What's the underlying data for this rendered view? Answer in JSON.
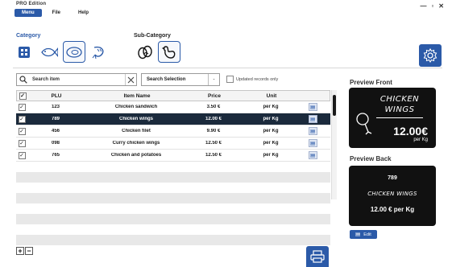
{
  "window": {
    "edition": "PRO Edition",
    "controls": [
      "—",
      "▫",
      "✕"
    ]
  },
  "menu": {
    "items": [
      "Menu",
      "File",
      "Help"
    ],
    "active": "Menu"
  },
  "category": {
    "title": "Category"
  },
  "subcategory": {
    "title": "Sub-Category"
  },
  "search": {
    "placeholder": "Search item",
    "selection_label": "Search Selection",
    "selection_arrow": "-",
    "updated_only_label": "Updated records only"
  },
  "table": {
    "headers": {
      "plu": "PLU",
      "name": "Item Name",
      "price": "Price",
      "unit": "Unit"
    },
    "rows": [
      {
        "checked": true,
        "plu": "123",
        "name": "Chicken sandwich",
        "price": "3.50 €",
        "unit": "per Kg",
        "selected": false
      },
      {
        "checked": true,
        "plu": "789",
        "name": "Chicken wings",
        "price": "12.00 €",
        "unit": "per Kg",
        "selected": true
      },
      {
        "checked": true,
        "plu": "456",
        "name": "Chicken filet",
        "price": "9.90 €",
        "unit": "per Kg",
        "selected": false
      },
      {
        "checked": true,
        "plu": "098",
        "name": "Curry chicken wings",
        "price": "12.50 €",
        "unit": "per Kg",
        "selected": false
      },
      {
        "checked": true,
        "plu": "765",
        "name": "Chicken and potatoes",
        "price": "12.50 €",
        "unit": "per Kg",
        "selected": false
      }
    ],
    "check_mark": "✓"
  },
  "controls": {
    "add": "+",
    "remove": "−"
  },
  "preview_front": {
    "title": "Preview Front",
    "name_line1": "CHICKEN",
    "name_line2": "WINGS",
    "price": "12.00€",
    "unit": "per Kg"
  },
  "preview_back": {
    "title": "Preview Back",
    "plu": "789",
    "name": "CHICKEN WINGS",
    "price": "12.00 € per Kg",
    "edit_label": "Edit"
  },
  "colors": {
    "accent": "#2b5aa8",
    "selected_row": "#1b2a3c",
    "preview_bg": "#111111"
  }
}
